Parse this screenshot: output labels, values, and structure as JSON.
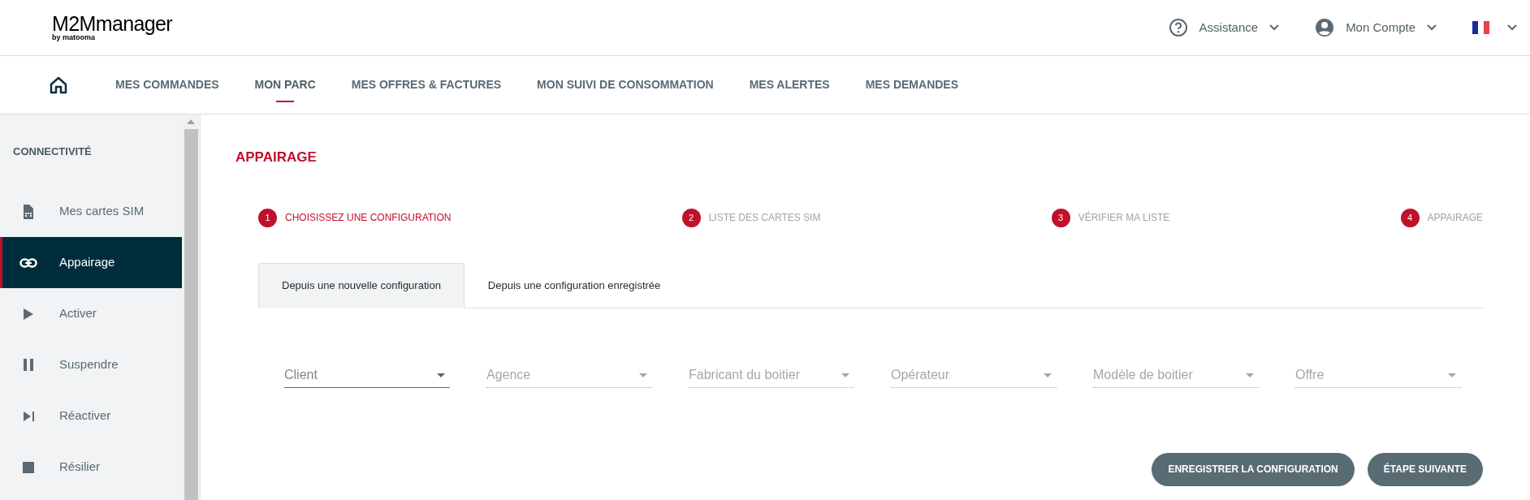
{
  "logo": {
    "name": "M2Mmanager",
    "byline": "by matooma"
  },
  "header_menu": [
    {
      "kind": "help",
      "label": "Assistance"
    },
    {
      "kind": "account",
      "label": "Mon Compte"
    },
    {
      "kind": "flag"
    }
  ],
  "nav": [
    {
      "kind": "home",
      "selected": false
    },
    {
      "label": "MES COMMANDES",
      "selected": false
    },
    {
      "label": "MON PARC",
      "selected": true
    },
    {
      "label": "MES OFFRES & FACTURES",
      "selected": false
    },
    {
      "label": "MON SUIVI DE CONSOMMATION",
      "selected": false
    },
    {
      "label": "MES ALERTES",
      "selected": false
    },
    {
      "label": "MES DEMANDES",
      "selected": false
    }
  ],
  "sidebar": {
    "title": "CONNECTIVITÉ",
    "items": [
      {
        "kind": "sim",
        "label": "Mes cartes SIM",
        "selected": false
      },
      {
        "kind": "link",
        "label": "Appairage",
        "selected": true
      },
      {
        "kind": "play",
        "label": "Activer",
        "selected": false
      },
      {
        "kind": "pause",
        "label": "Suspendre",
        "selected": false
      },
      {
        "kind": "next",
        "label": "Réactiver",
        "selected": false
      },
      {
        "kind": "stop",
        "label": "Résilier",
        "selected": false
      }
    ]
  },
  "page_title": "APPAIRAGE",
  "steps": [
    {
      "number": "1",
      "label": "CHOISISSEZ UNE CONFIGURATION",
      "selected": true
    },
    {
      "number": "2",
      "label": "LISTE DES CARTES SIM",
      "selected": false
    },
    {
      "number": "3",
      "label": "VÉRIFIER MA LISTE",
      "selected": false
    },
    {
      "number": "4",
      "label": "APPAIRAGE",
      "selected": false
    }
  ],
  "tabs": [
    {
      "label": "Depuis une nouvelle configuration",
      "selected": true
    },
    {
      "label": "Depuis une configuration enregistrée",
      "selected": false
    }
  ],
  "fields": [
    {
      "placeholder": "Client",
      "disabled": false
    },
    {
      "placeholder": "Agence",
      "disabled": true
    },
    {
      "placeholder": "Fabricant du boitier",
      "disabled": true
    },
    {
      "placeholder": "Opérateur",
      "disabled": true
    },
    {
      "placeholder": "Modèle de boitier",
      "disabled": true
    },
    {
      "placeholder": "Offre",
      "disabled": true
    }
  ],
  "buttons": [
    "ENREGISTRER LA CONFIGURATION",
    "ÉTAPE SUIVANTE"
  ]
}
